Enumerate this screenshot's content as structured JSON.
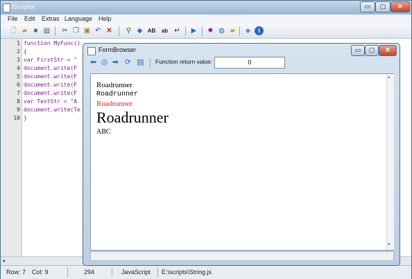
{
  "window": {
    "title": "JScriptor",
    "controls": {
      "minimize": "▭",
      "maximize": "▢",
      "close": "✕"
    }
  },
  "menu": [
    "File",
    "Edit",
    "Extras",
    "Language",
    "Help"
  ],
  "editor": {
    "line_numbers": [
      "1",
      "2",
      "3",
      "4",
      "5",
      "6",
      "7",
      "8",
      "9",
      "10"
    ],
    "lines": [
      "function MyFunc()",
      "{",
      "var FirstStr = \"",
      "document.write(F",
      "document.write(F",
      "document.write(F",
      "document.write(F",
      "var TestStr = \"A",
      "document.write(Te",
      "}"
    ]
  },
  "status": {
    "row": "Row: 7",
    "col": "Col: 9",
    "chars": "294",
    "language": "JavaScript",
    "path": "E:\\scripts\\String.js"
  },
  "form_browser": {
    "title": "FormBrowser",
    "function_label": "Function return value:",
    "function_value": "0",
    "output": [
      {
        "text": "Roadrunner",
        "style": "normal"
      },
      {
        "text": "Roadrunner",
        "style": "mono"
      },
      {
        "text": "Roadrunner",
        "style": "red"
      },
      {
        "text": "Roadrunner",
        "style": "big"
      },
      {
        "text": "ABC",
        "style": "small"
      }
    ]
  },
  "colors": {
    "red_text": "#e02020"
  }
}
